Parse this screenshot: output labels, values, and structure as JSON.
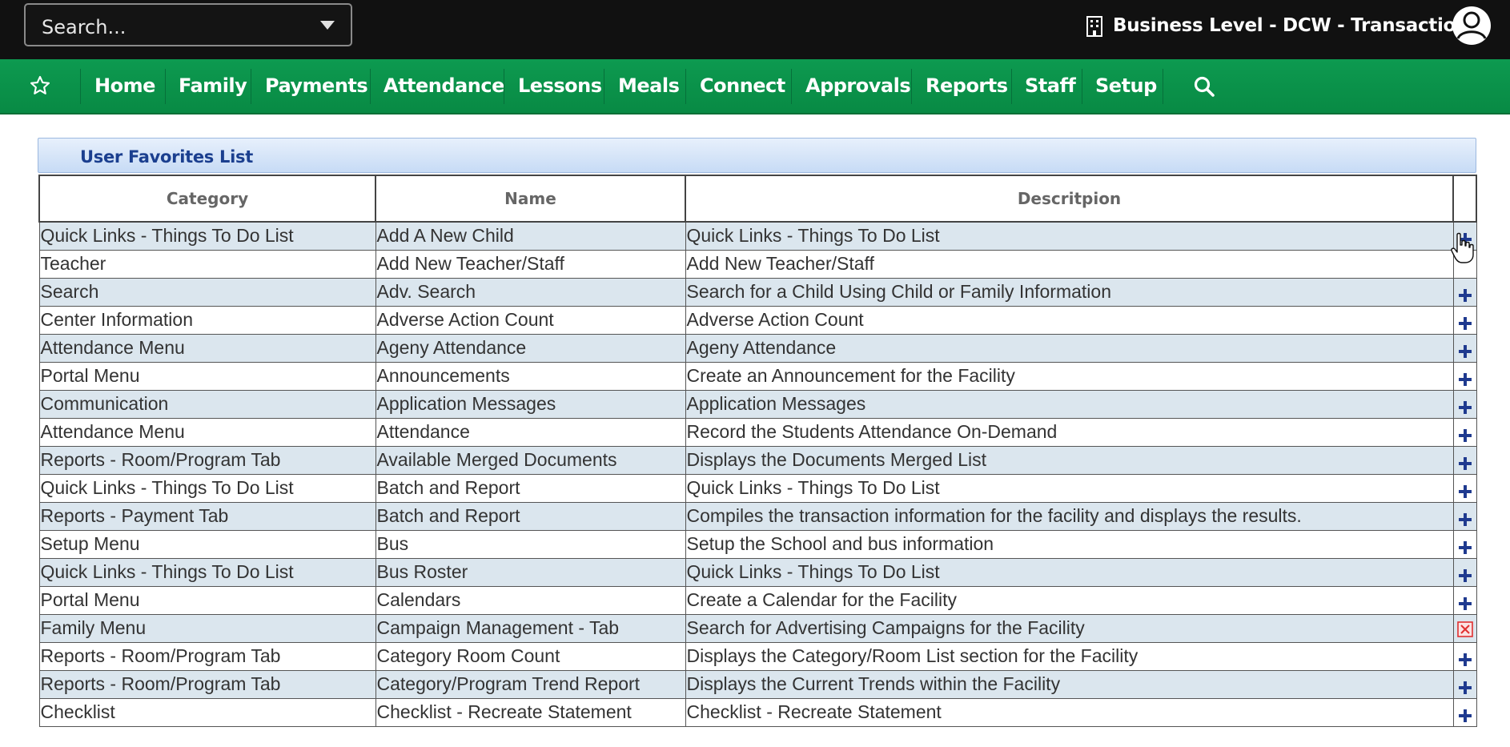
{
  "header": {
    "search_placeholder": "Search...",
    "business_label": "Business Level - DCW - Transactional"
  },
  "nav": {
    "items": [
      "Home",
      "Family",
      "Payments",
      "Attendance",
      "Lessons",
      "Meals",
      "Connect",
      "Approvals",
      "Reports",
      "Staff",
      "Setup"
    ]
  },
  "panel": {
    "title": "User Favorites List",
    "columns": [
      "Category",
      "Name",
      "Descritpion"
    ],
    "rows": [
      {
        "category": "Quick Links - Things To Do List",
        "name": "Add A New Child",
        "description": "Quick Links - Things To Do List",
        "action": "add"
      },
      {
        "category": "Teacher",
        "name": "Add New Teacher/Staff",
        "description": "Add New Teacher/Staff",
        "action": "none"
      },
      {
        "category": "Search",
        "name": "Adv. Search",
        "description": "Search for a Child Using Child or Family Information",
        "action": "add"
      },
      {
        "category": "Center Information",
        "name": "Adverse Action Count",
        "description": "Adverse Action Count",
        "action": "add"
      },
      {
        "category": "Attendance Menu",
        "name": "Ageny Attendance",
        "description": "Ageny Attendance",
        "action": "add"
      },
      {
        "category": "Portal Menu",
        "name": "Announcements",
        "description": "Create an Announcement for the Facility",
        "action": "add"
      },
      {
        "category": "Communication",
        "name": "Application Messages",
        "description": "Application Messages",
        "action": "add"
      },
      {
        "category": "Attendance Menu",
        "name": "Attendance",
        "description": "Record the Students Attendance On-Demand",
        "action": "add"
      },
      {
        "category": "Reports - Room/Program Tab",
        "name": "Available Merged Documents",
        "description": "Displays the Documents Merged List",
        "action": "add"
      },
      {
        "category": "Quick Links - Things To Do List",
        "name": "Batch and Report",
        "description": "Quick Links - Things To Do List",
        "action": "add"
      },
      {
        "category": "Reports - Payment Tab",
        "name": "Batch and Report",
        "description": "Compiles the transaction information for the facility and displays the results.",
        "action": "add"
      },
      {
        "category": "Setup Menu",
        "name": "Bus",
        "description": "Setup the School and bus information",
        "action": "add"
      },
      {
        "category": "Quick Links - Things To Do List",
        "name": "Bus Roster",
        "description": "Quick Links - Things To Do List",
        "action": "add"
      },
      {
        "category": "Portal Menu",
        "name": "Calendars",
        "description": "Create a Calendar for the Facility",
        "action": "add"
      },
      {
        "category": "Family Menu",
        "name": "Campaign Management - Tab",
        "description": "Search for Advertising Campaigns for the Facility",
        "action": "remove"
      },
      {
        "category": "Reports - Room/Program Tab",
        "name": "Category Room Count",
        "description": "Displays the Category/Room List section for the Facility",
        "action": "add"
      },
      {
        "category": "Reports - Room/Program Tab",
        "name": "Category/Program Trend Report",
        "description": "Displays the Current Trends within the Facility",
        "action": "add"
      },
      {
        "category": "Checklist",
        "name": "Checklist - Recreate Statement",
        "description": "Checklist - Recreate Statement",
        "action": "add"
      }
    ]
  },
  "colors": {
    "topbar": "#111111",
    "nav_green": "#0a9249",
    "row_alt": "#dbe6ee",
    "plus_icon": "#1f3a8f",
    "remove_icon": "#e03030"
  },
  "icons": {
    "nav_star": "star-outline-icon",
    "nav_search": "magnifier-icon",
    "business": "building-icon",
    "avatar": "user-circle-icon",
    "add": "plus-icon",
    "remove": "remove-favorite-icon"
  }
}
